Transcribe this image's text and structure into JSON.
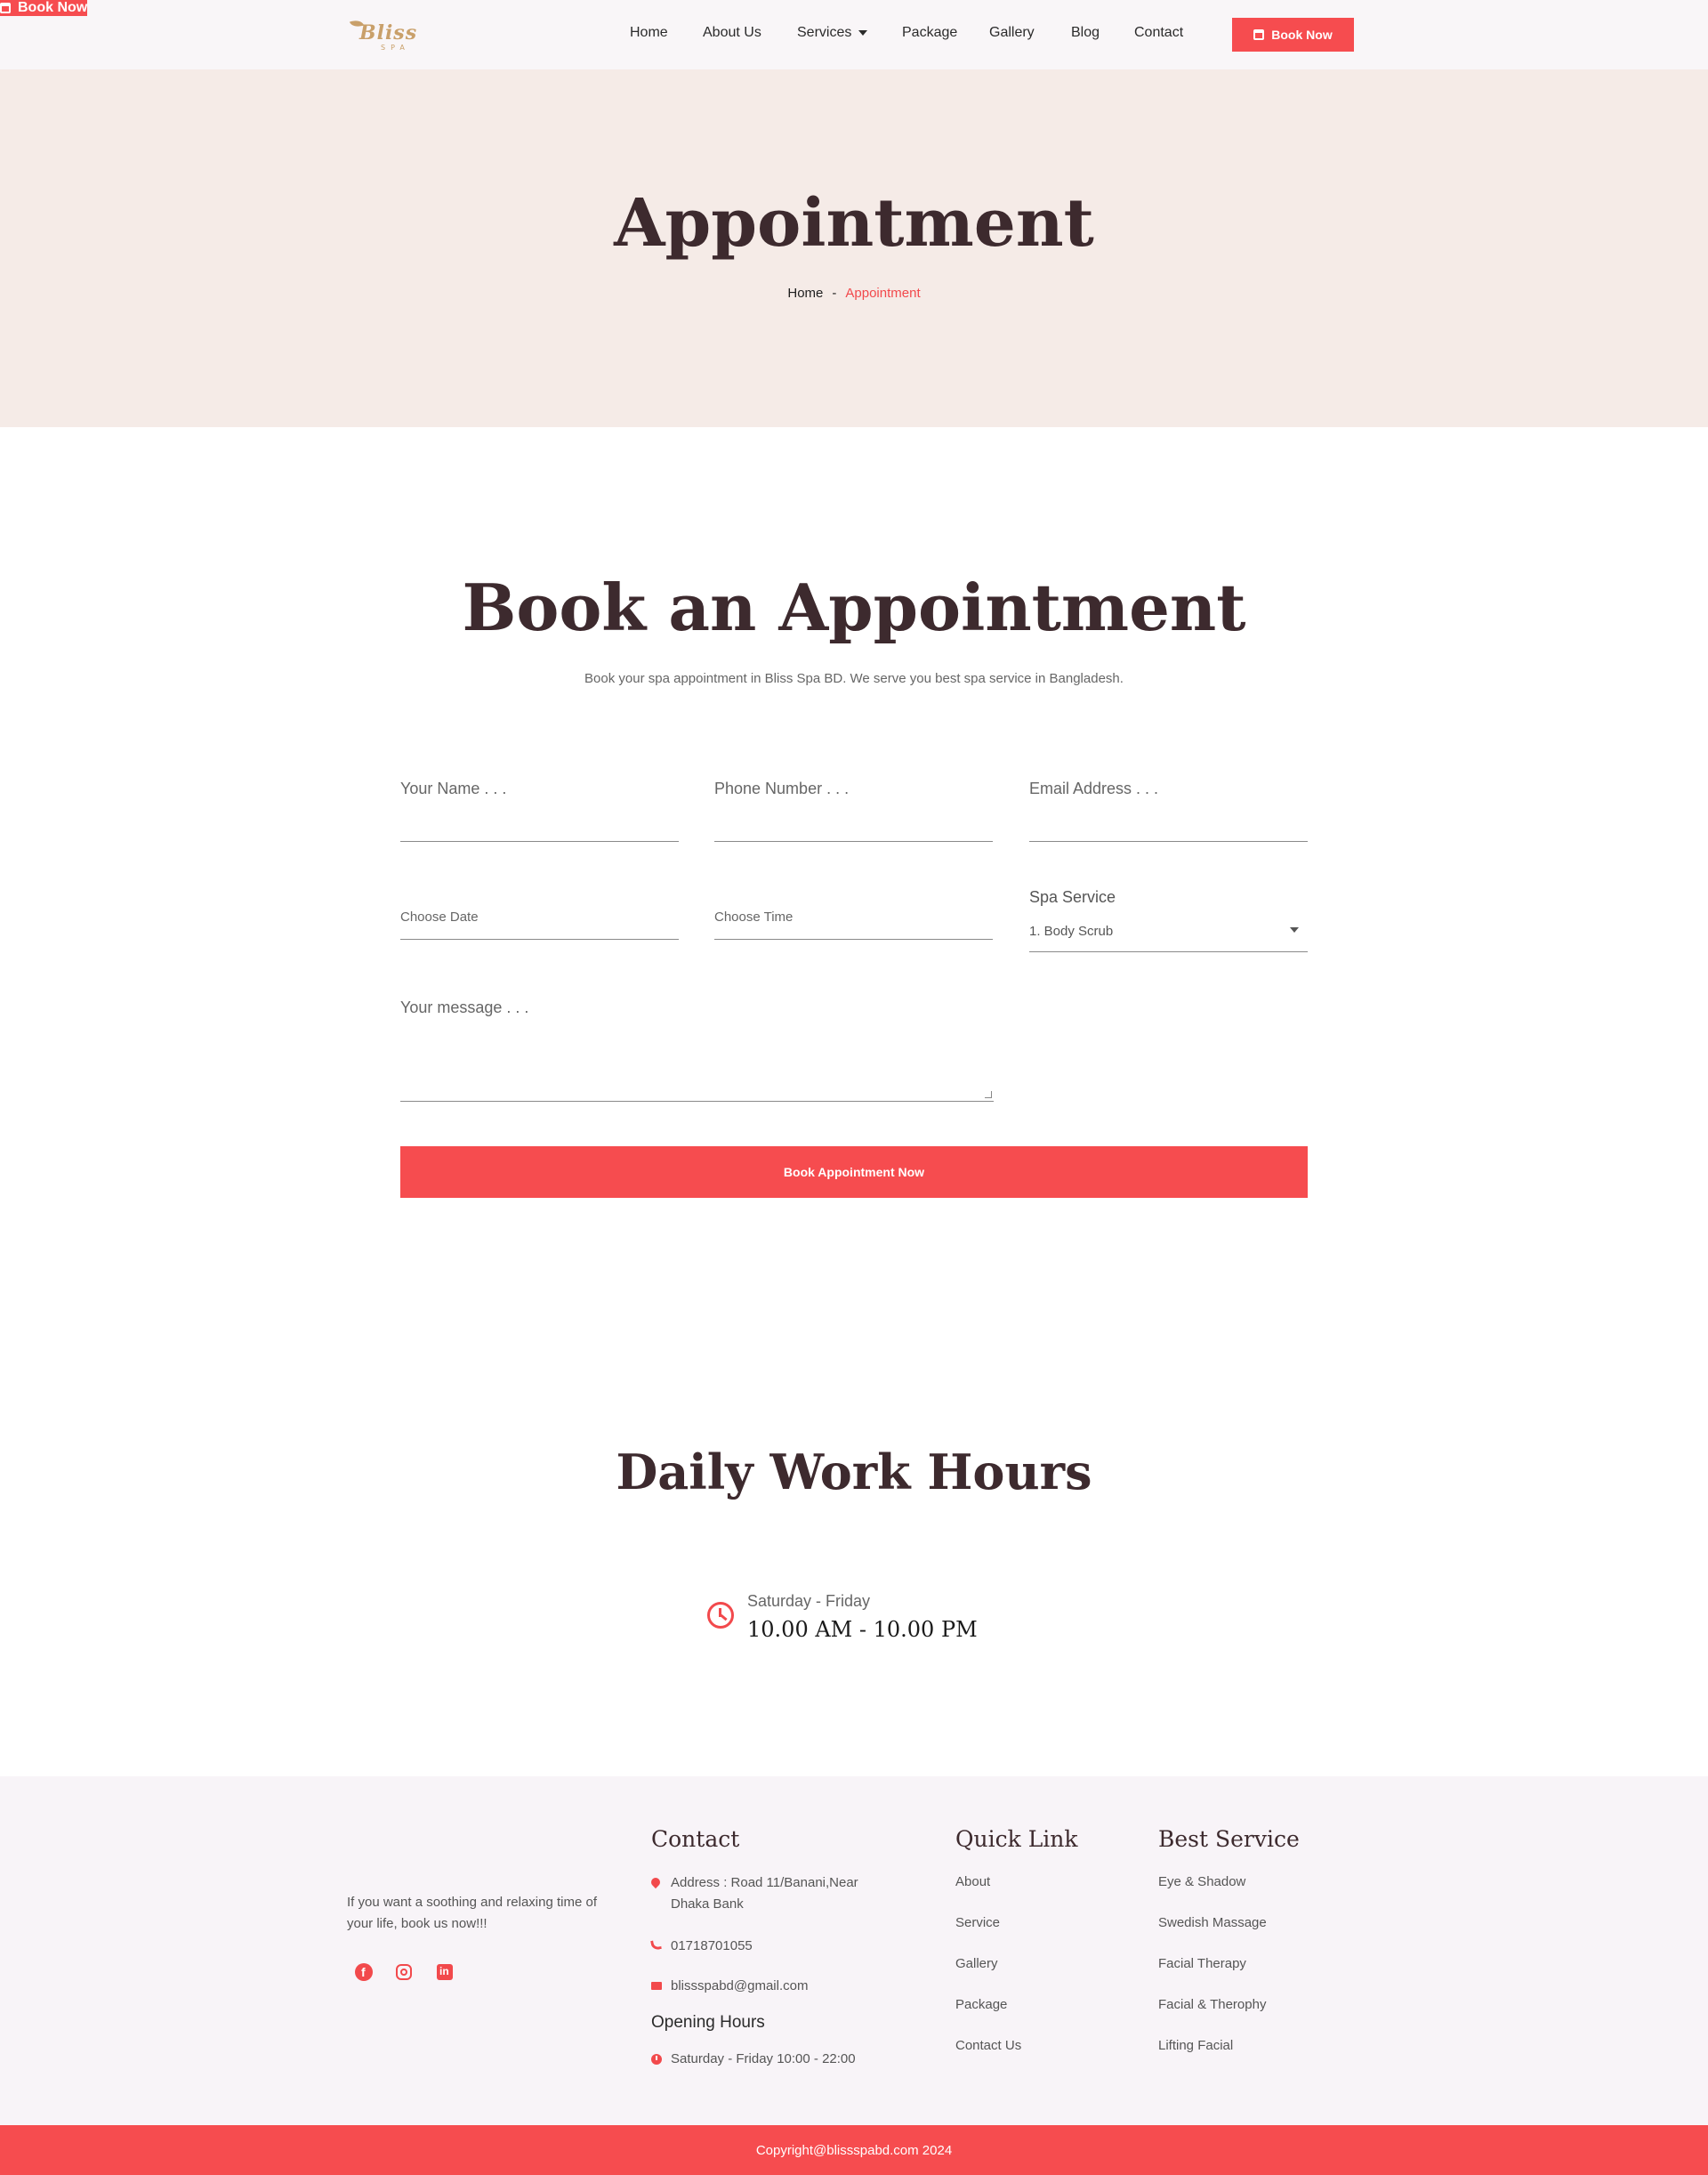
{
  "brand": {
    "logo_word": "Bliss",
    "logo_sub": "SPA"
  },
  "nav": {
    "home": "Home",
    "about": "About Us",
    "services": "Services",
    "package": "Package",
    "gallery": "Gallery",
    "blog": "Blog",
    "contact": "Contact",
    "book_now": "Book Now"
  },
  "hero": {
    "title": "Appointment",
    "breadcrumb_home": "Home",
    "breadcrumb_sep": "-",
    "breadcrumb_current": "Appointment"
  },
  "booking": {
    "title": "Book an Appointment",
    "subtitle": "Book your spa appointment in Bliss Spa BD. We serve you best spa service in Bangladesh.",
    "name_placeholder": "Your Name . . .",
    "phone_placeholder": "Phone Number . . .",
    "email_placeholder": "Email Address . . .",
    "date_placeholder": "Choose Date",
    "time_placeholder": "Choose Time",
    "service_label": "Spa Service",
    "service_selected": "1. Body Scrub",
    "message_placeholder": "Your message . . .",
    "submit": "Book Appointment Now"
  },
  "hours": {
    "title": "Daily Work Hours",
    "days": "Saturday - Friday",
    "time": "10.00 AM - 10.00 PM"
  },
  "footer": {
    "about": "If you want a soothing and relaxing time of your life, book us now!!!",
    "social": {
      "facebook": "f",
      "linkedin": "in"
    },
    "book_now": "Book Now",
    "contact_title": "Contact",
    "address": "Address : Road 11/Banani,Near Dhaka Bank",
    "phone": "01718701055",
    "email": "blissspabd@gmail.com",
    "opening_title": "Opening Hours",
    "opening_hours": "Saturday - Friday 10:00 - 22:00",
    "quick_title": "Quick Link",
    "quick_links": [
      "About",
      "Service",
      "Gallery",
      "Package",
      "Contact Us"
    ],
    "best_title": "Best Service",
    "best_services": [
      "Eye & Shadow",
      "Swedish Massage",
      "Facial Therapy",
      "Facial & Therophy",
      "Lifting Facial"
    ],
    "copyright": "Copyright@blissspabd.com 2024"
  },
  "colors": {
    "accent": "#f64c4f",
    "gold": "#c9a06a",
    "hero_bg": "#f5ebe7",
    "footer_bg": "#f8f4f8",
    "heading": "#3d2a2e"
  },
  "icons": {
    "header_button": "calendar-icon",
    "hours": "clock-icon",
    "address": "map-pin-icon",
    "phone": "phone-icon",
    "email": "envelope-icon",
    "opening": "clock-icon"
  }
}
